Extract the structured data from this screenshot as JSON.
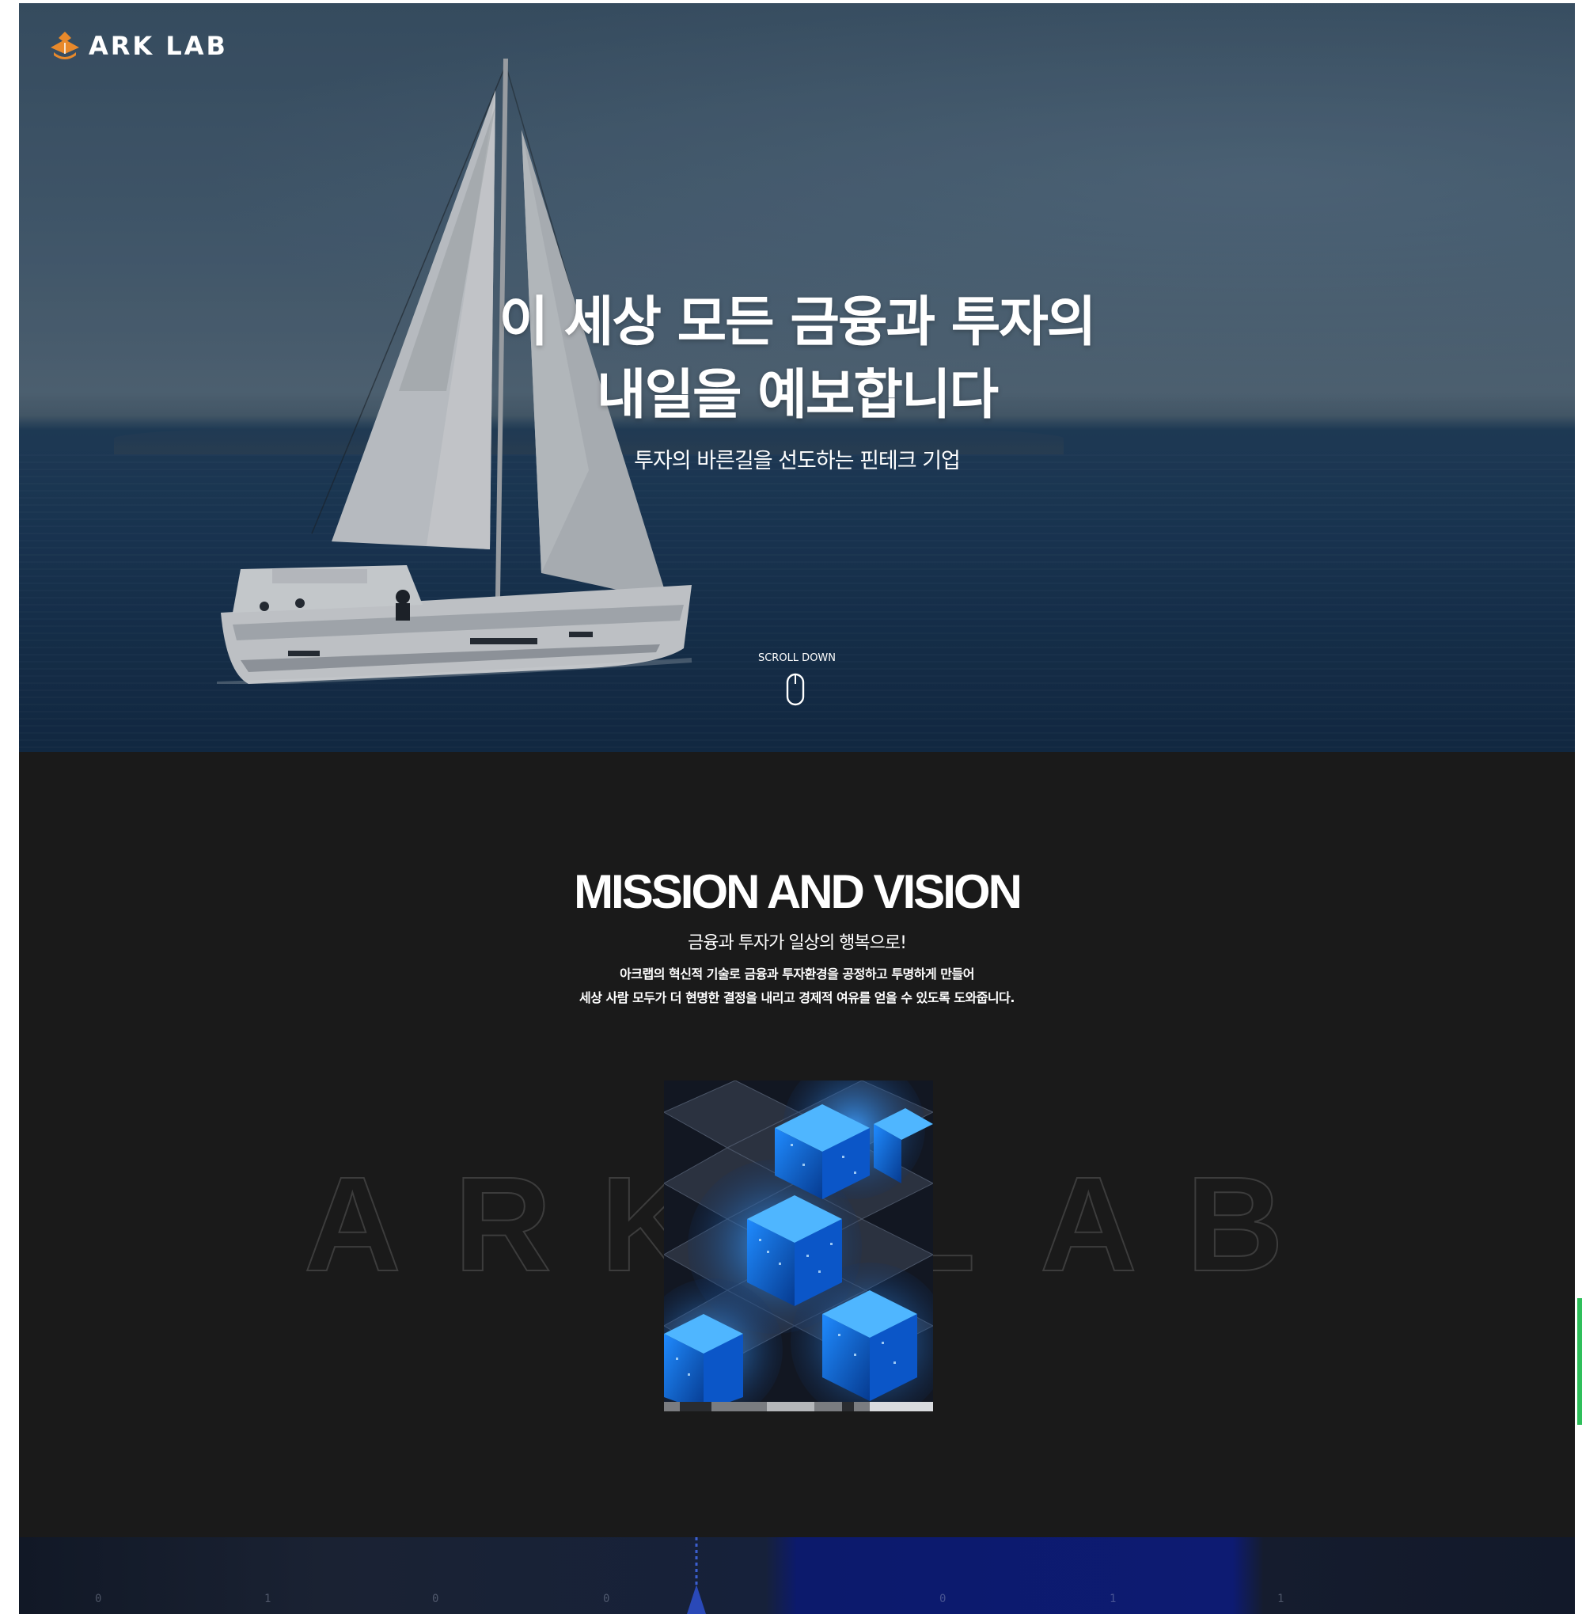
{
  "brand": {
    "name": "ARK LAB",
    "accent_color": "#e8892b",
    "logo_icon": "ark-logo-icon"
  },
  "hero": {
    "title_line1": "이 세상 모든 금융과 투자의",
    "title_line2": "내일을 예보합니다",
    "subtitle": "투자의 바른길을 선도하는 핀테크 기업",
    "scroll_label": "SCROLL DOWN",
    "scroll_icon": "mouse-icon"
  },
  "mission": {
    "title": "MISSION AND VISION",
    "subtitle": "금융과 투자가 일상의 행복으로!",
    "desc_line1": "아크랩의 혁신적 기술로 금융과 투자환경을 공정하고 투명하게 만들어",
    "desc_line2": "세상 사람 모두가 더 현명한 결정을 내리고 경제적 여유를 얻을 수 있도록 도와줍니다.",
    "outline_word": "ARKLAB",
    "image_icon": "blockchain-cubes-image"
  },
  "bottom_strip": {
    "digits": [
      "0",
      "1",
      "0",
      "0",
      "0",
      "1",
      "1"
    ]
  }
}
